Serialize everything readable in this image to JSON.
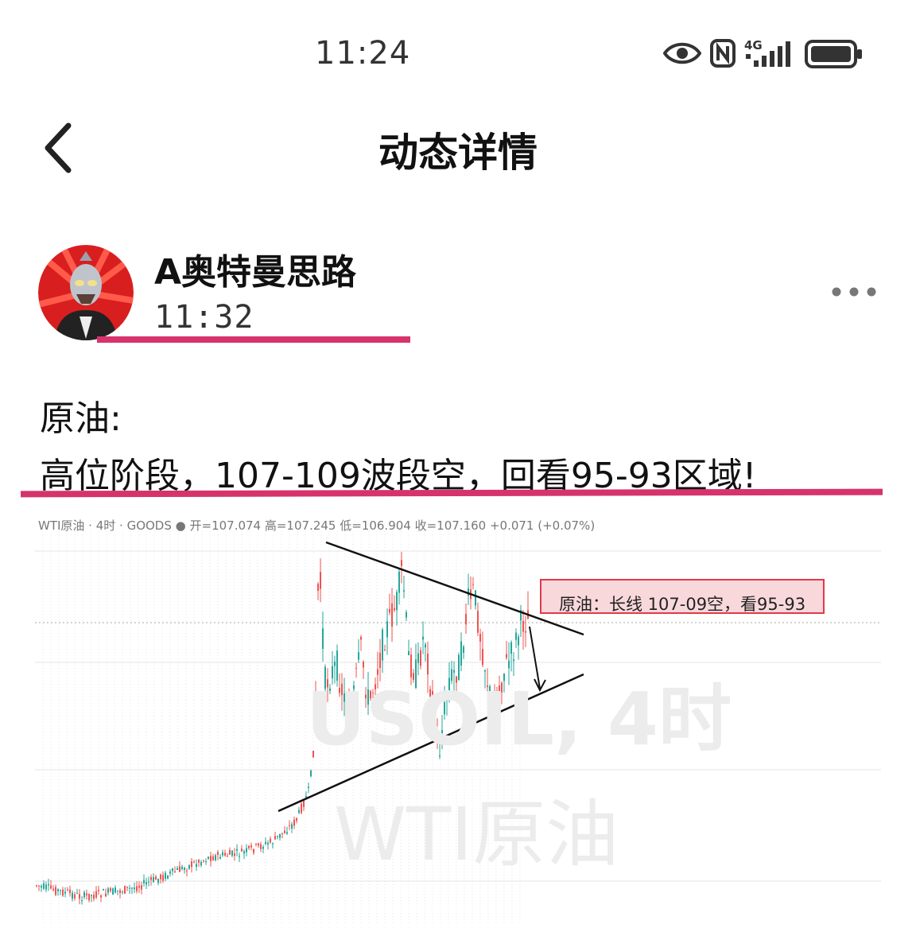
{
  "status_bar": {
    "time": "11:24",
    "network_label": "4G",
    "icons": [
      "eye-icon",
      "nfc-icon",
      "signal-icon",
      "battery-icon"
    ]
  },
  "header": {
    "title": "动态详情",
    "back_icon": "chevron-left-icon"
  },
  "post": {
    "author_name": "A奥特曼思路",
    "time": "11:32",
    "more_icon": "more-dots-icon",
    "lines": [
      "原油:",
      "高位阶段，107-109波段空，回看95-93区域!"
    ]
  },
  "chart_image": {
    "header_text": "WTI原油 · 4时 · GOODS ● 开=107.074 高=107.245 低=106.904 收=107.160 +0.071 (+0.07%)",
    "watermark_lines": [
      "USOIL, 4时",
      "WTI原油"
    ],
    "annotation": "原油：长线 107-09空，看95-93"
  },
  "colors": {
    "accent_underline": "#d6336c",
    "candle_up": "#26a69a",
    "candle_down": "#ef5350",
    "annotation_border": "#e03a48",
    "annotation_fill": "#f9d8dc"
  }
}
